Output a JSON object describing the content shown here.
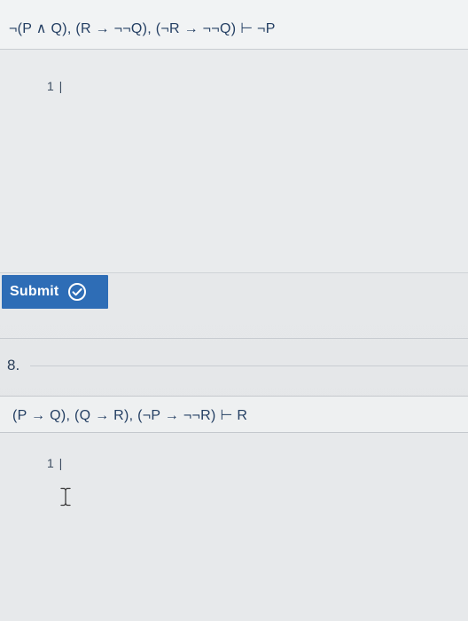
{
  "problem7": {
    "formula": "¬(P ∧ Q), (R → ¬¬Q), (¬R → ¬¬Q) ⊢ ¬P",
    "line_label": "1 |"
  },
  "submit": {
    "label": "Submit",
    "icon": "check-circle-icon",
    "color": "#2e6db6"
  },
  "problem8": {
    "number": "8.",
    "formula": "(P → Q), (Q → R), (¬P → ¬¬R) ⊢ R",
    "line_label": "1 |"
  },
  "cursor": {
    "icon": "text-ibeam-cursor-icon"
  }
}
